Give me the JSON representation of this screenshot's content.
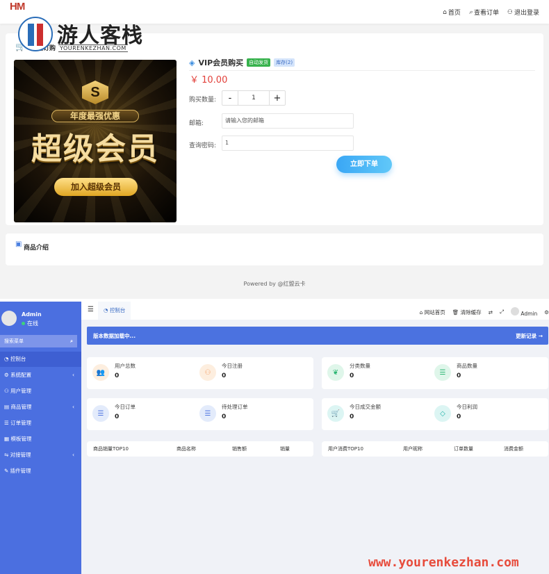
{
  "header": {
    "logo_text": "HM",
    "nav": [
      {
        "icon": "home-icon",
        "label": "首页"
      },
      {
        "icon": "search-icon",
        "label": "查看订单"
      },
      {
        "icon": "user-icon",
        "label": "退出登录"
      }
    ]
  },
  "watermark": {
    "title": "游人客栈",
    "subtitle": "YOURENKEZHAN.COM",
    "footer": "www.yourenkezhan.com"
  },
  "product": {
    "card_title": "商品订购",
    "image": {
      "sub": "年度最强优惠",
      "big": "超级会员",
      "button": "加入超级会员",
      "badge": "S"
    },
    "name": "VIP会员购买",
    "tag_auto": "自动发货",
    "tag_stock": "库存(2)",
    "price": "￥ 10.00",
    "qty_label": "购买数量:",
    "qty_value": "1",
    "email_label": "邮箱:",
    "email_placeholder": "请输入您的邮箱",
    "password_label": "查询密码:",
    "password_value": "1",
    "buy_button": "立即下单"
  },
  "intro": {
    "title": "商品介绍"
  },
  "powered": "Powered by @红盟云卡",
  "admin": {
    "user": {
      "name": "Admin",
      "status": "在线"
    },
    "search_label": "搜索菜单",
    "menu": [
      {
        "icon": "dashboard-icon",
        "label": "控制台",
        "has_sub": false
      },
      {
        "icon": "gear-icon",
        "label": "系统配置",
        "has_sub": true
      },
      {
        "icon": "user-icon",
        "label": "用户管理",
        "has_sub": false
      },
      {
        "icon": "cart-icon",
        "label": "商品管理",
        "has_sub": true
      },
      {
        "icon": "list-icon",
        "label": "订单管理",
        "has_sub": false
      },
      {
        "icon": "template-icon",
        "label": "模板管理",
        "has_sub": false
      },
      {
        "icon": "plug-icon",
        "label": "对接管理",
        "has_sub": true
      },
      {
        "icon": "puzzle-icon",
        "label": "插件管理",
        "has_sub": false
      }
    ],
    "topbar": {
      "tab": "控制台",
      "site_home": "网站首页",
      "clear_cache": "清除缓存",
      "user": "Admin"
    },
    "notice": {
      "left": "版本数据加载中...",
      "right": "更新记录 →"
    },
    "stats": [
      {
        "label": "用户总数",
        "value": "0",
        "icon": "users-icon",
        "color": "#f5a26a",
        "bg": "#fdeedf"
      },
      {
        "label": "今日注册",
        "value": "0",
        "icon": "user-add-icon",
        "color": "#f5a26a",
        "bg": "#fdeedf"
      },
      {
        "label": "分类数量",
        "value": "0",
        "icon": "leaf-icon",
        "color": "#2bb673",
        "bg": "#dff6ea"
      },
      {
        "label": "商品数量",
        "value": "0",
        "icon": "list-icon",
        "color": "#2bb673",
        "bg": "#dff6ea"
      },
      {
        "label": "今日订单",
        "value": "0",
        "icon": "list-icon",
        "color": "#4b72e0",
        "bg": "#e3ebfb"
      },
      {
        "label": "待处理订单",
        "value": "0",
        "icon": "list-icon",
        "color": "#4b72e0",
        "bg": "#e3ebfb"
      },
      {
        "label": "今日成交金额",
        "value": "0",
        "icon": "cart-icon",
        "color": "#20b2a8",
        "bg": "#dcf5f3"
      },
      {
        "label": "今日利润",
        "value": "0",
        "icon": "diamond-icon",
        "color": "#20b2a8",
        "bg": "#dcf5f3"
      }
    ],
    "table_left": [
      "商品销量TOP10",
      "商品名称",
      "销售额",
      "销量"
    ],
    "table_right": [
      "用户消费TOP10",
      "用户昵称",
      "订单数量",
      "消费金额"
    ]
  }
}
